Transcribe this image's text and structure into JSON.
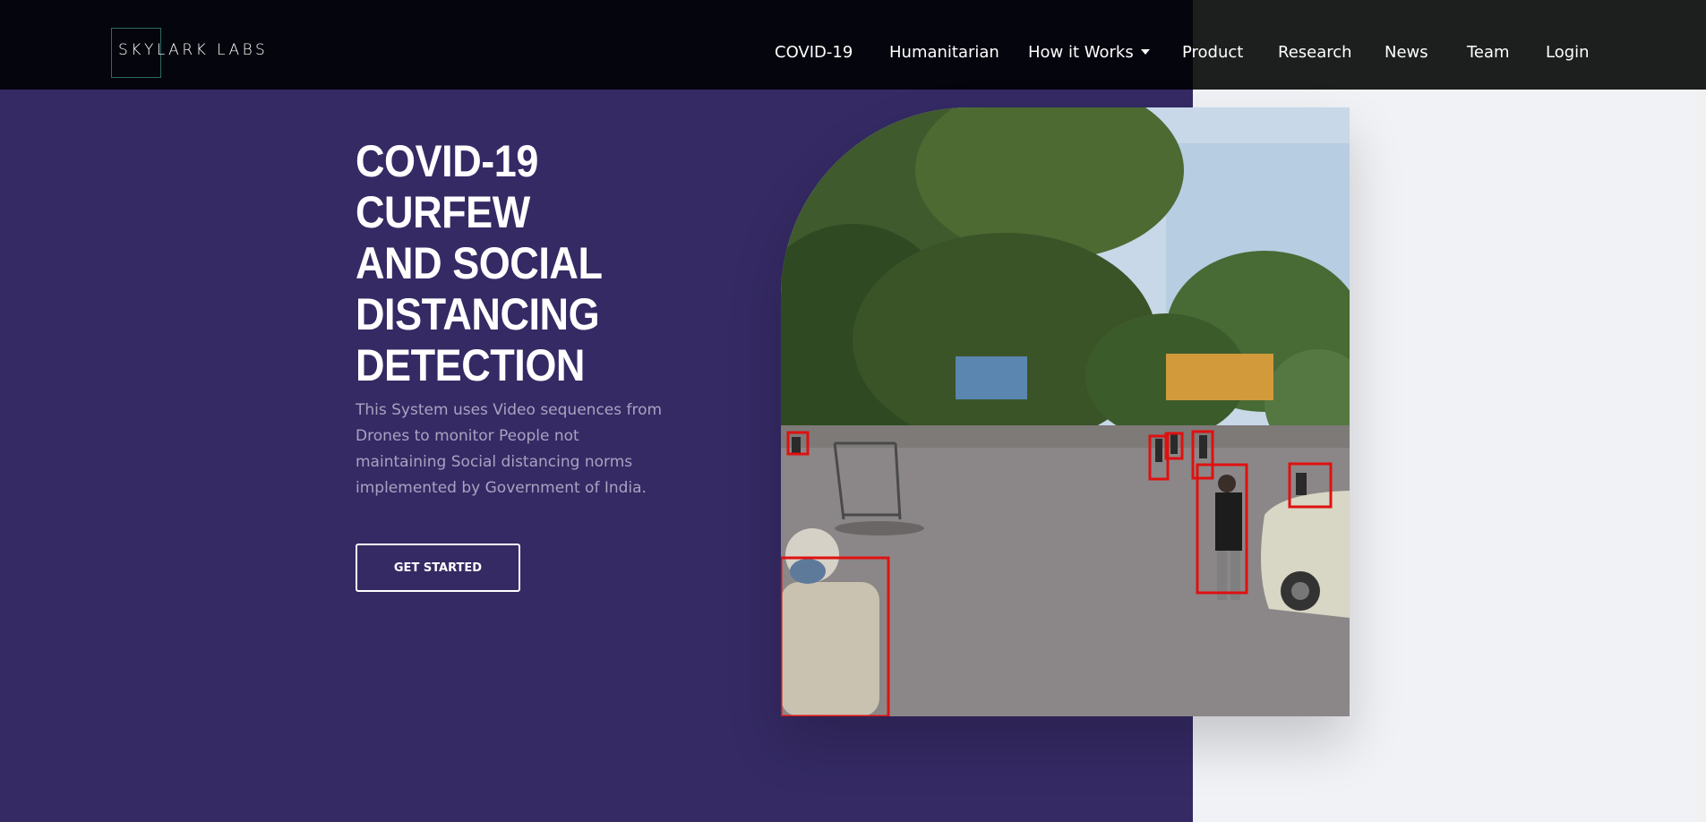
{
  "brand": {
    "logo_text": "SKYLARK LABS"
  },
  "nav": {
    "items": [
      {
        "label": "COVID-19"
      },
      {
        "label": "Humanitarian"
      },
      {
        "label": "How it Works"
      },
      {
        "label": "Product"
      },
      {
        "label": "Research"
      },
      {
        "label": "News"
      },
      {
        "label": "Team"
      },
      {
        "label": "Login"
      }
    ]
  },
  "hero": {
    "title": "COVID-19 CURFEW AND SOCIAL DISTANCING DETECTION",
    "description": "This System uses Video sequences from Drones to monitor People not maintaining Social distancing norms implemented by Government of India.",
    "cta_label": "GET STARTED"
  },
  "colors": {
    "hero_bg": "#352a64",
    "header_bg": "#05050d",
    "right_bg": "#f1f2f6",
    "detection_box": "#e01010"
  }
}
